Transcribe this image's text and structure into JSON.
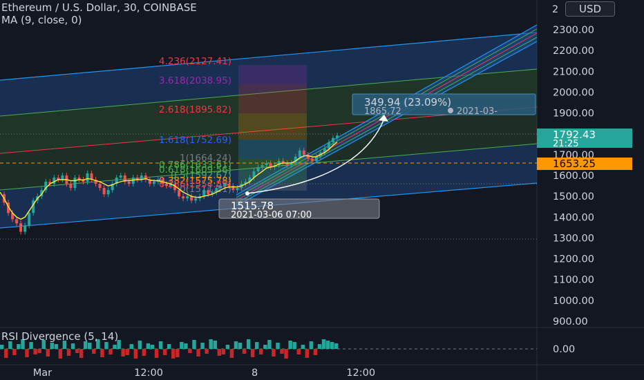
{
  "header": {
    "title": "Ethereum / U.S. Dollar, 30, COINBASE",
    "indicator": "MA (9, close, 0)",
    "currency_button": "USD"
  },
  "rsi_panel": {
    "label": "RSI Divergence (5, 14)",
    "value_label": "0.00"
  },
  "price_tags": {
    "current_price": "1792.43",
    "countdown": "21:25",
    "dashed_level": "1653.25",
    "colors": {
      "current": "#26a69a",
      "level": "#ff9800"
    }
  },
  "measure": {
    "change": "349.94 (23.09%)",
    "target": "1865.72",
    "target_date": "2021-03-",
    "start_price": "1515.78",
    "start_time": "2021-03-06 07:00"
  },
  "fib_levels": [
    {
      "label": "4.236(2127.41)",
      "color": "#f23645"
    },
    {
      "label": "3.618(2038.95)",
      "color": "#9c27b0"
    },
    {
      "label": "2.618(1895.82)",
      "color": "#f23645"
    },
    {
      "label": "1.618(1752.69)",
      "color": "#2962ff"
    },
    {
      "label": "1(1664.24)",
      "color": "#787b86"
    },
    {
      "label": "0.786(1633.61)",
      "color": "#4caf50"
    },
    {
      "label": "0.618(1609.56)",
      "color": "#4caf50"
    },
    {
      "label": "0.5(1592.67)",
      "color": "#4caf50"
    },
    {
      "label": "0.382(1575.78)",
      "color": "#ff9800"
    },
    {
      "label": "0.236(1554.89)",
      "color": "#f23645"
    },
    {
      "label": "0(1511.11)",
      "color": "#787b86"
    }
  ],
  "chart_data": {
    "type": "line",
    "title": "Ethereum / U.S. Dollar, 30, COINBASE",
    "y_ticks": [
      "2300.00",
      "2200.00",
      "2100.00",
      "2000.00",
      "1900.00",
      "1700.00",
      "1600.00",
      "1500.00",
      "1400.00",
      "1300.00",
      "1200.00",
      "1100.00",
      "1000.00",
      "900.00"
    ],
    "y_tick_values": [
      2300,
      2200,
      2100,
      2000,
      1900,
      1700,
      1600,
      1500,
      1400,
      1300,
      1200,
      1100,
      1000,
      900
    ],
    "x_ticks": [
      "Mar",
      "12:00",
      "8",
      "12:00"
    ],
    "ylim": [
      840,
      2420
    ],
    "xlim": [
      0,
      125
    ],
    "x_tick_positions": [
      12,
      42,
      72,
      102
    ],
    "series": [
      {
        "values": [
          1510,
          1470,
          1420,
          1390,
          1370,
          1330,
          1360,
          1420,
          1480,
          1500,
          1530,
          1570,
          1560,
          1590,
          1580,
          1600,
          1560,
          1540,
          1590,
          1580,
          1570,
          1610,
          1580,
          1560,
          1540,
          1510,
          1530,
          1560,
          1590,
          1600,
          1570,
          1560,
          1590,
          1580,
          1600,
          1580,
          1560,
          1570,
          1580,
          1560,
          1550,
          1560,
          1530,
          1500,
          1490,
          1500,
          1480,
          1490,
          1500,
          1530,
          1510,
          1520,
          1540,
          1550,
          1560,
          1550,
          1530,
          1540,
          1560,
          1570,
          1590,
          1620,
          1640,
          1650,
          1660,
          1640,
          1650,
          1670,
          1660,
          1650,
          1660,
          1690,
          1720,
          1700,
          1680,
          1670,
          1690,
          1710,
          1730,
          1760,
          1780,
          1792
        ],
        "x_start": 0
      },
      {
        "name": "MA (9, close, 0)",
        "values": [
          1520,
          1490,
          1450,
          1420,
          1400,
          1390,
          1400,
          1430,
          1460,
          1490,
          1510,
          1540,
          1560,
          1570,
          1580,
          1580,
          1580,
          1575,
          1575,
          1580,
          1578,
          1585,
          1582,
          1575,
          1570,
          1560,
          1550,
          1555,
          1565,
          1570,
          1575,
          1575,
          1578,
          1580,
          1580,
          1585,
          1578,
          1575,
          1575,
          1570,
          1565,
          1560,
          1550,
          1535,
          1520,
          1510,
          1500,
          1495,
          1495,
          1500,
          1505,
          1510,
          1520,
          1530,
          1540,
          1545,
          1545,
          1545,
          1550,
          1560,
          1570,
          1590,
          1605,
          1620,
          1635,
          1640,
          1645,
          1655,
          1660,
          1660,
          1660,
          1670,
          1685,
          1695,
          1695,
          1690,
          1690,
          1700,
          1710,
          1725,
          1745,
          1760
        ],
        "x_start": 0
      }
    ],
    "rsi_values": [
      1,
      -1,
      1,
      -1,
      1,
      1,
      -1,
      1,
      -1,
      -1,
      1,
      -1,
      1,
      1,
      -1,
      1,
      -1,
      1,
      -1,
      -1,
      1,
      1,
      -1,
      1,
      -1,
      1,
      -1,
      1,
      1,
      -1,
      -1,
      1,
      -1,
      1,
      -1,
      1,
      1,
      -1,
      1,
      -1,
      1,
      -1,
      -1,
      1,
      1,
      -1,
      1,
      -1,
      1,
      -1,
      1,
      1,
      -1,
      -1,
      1,
      -1,
      1,
      1,
      -1,
      1,
      -1,
      1,
      -1,
      1,
      1,
      -1,
      1,
      -1,
      -1,
      1,
      1,
      -1,
      1,
      -1,
      1,
      -1,
      1,
      1,
      1,
      1,
      1
    ],
    "grid": false,
    "legend": "top-left"
  }
}
